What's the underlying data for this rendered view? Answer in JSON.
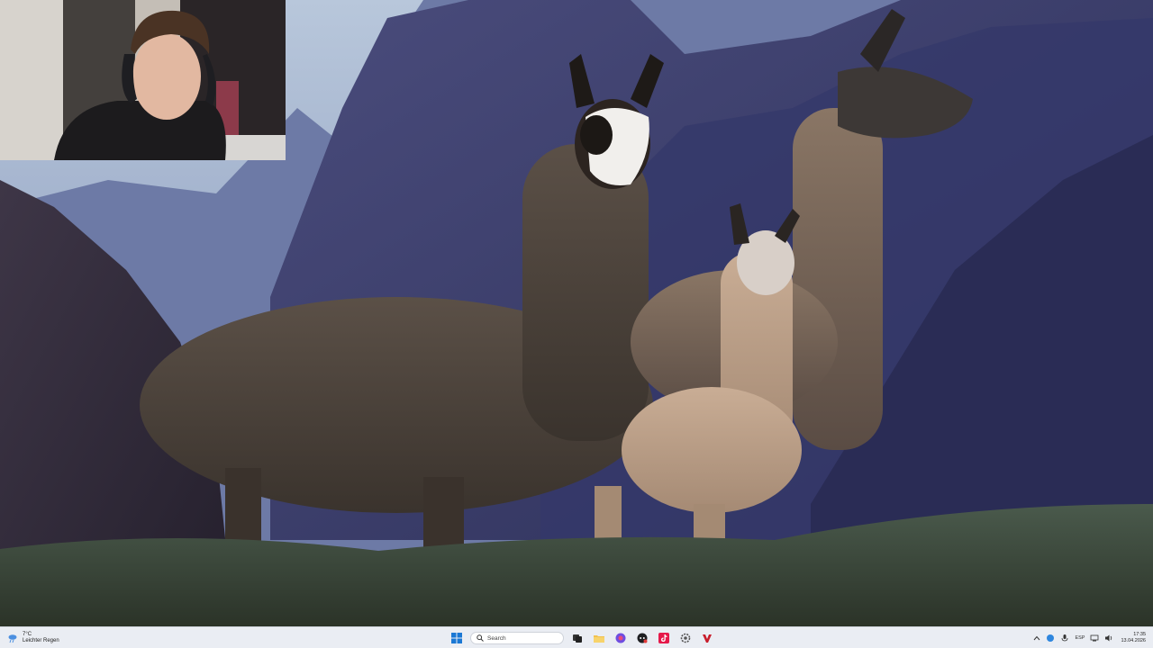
{
  "desktop": {
    "wallpaper": "llamas-in-mountains",
    "webcam_overlay": "streamer-webcam"
  },
  "taskbar": {
    "weather": {
      "temp": "7°C",
      "description": "Leichter Regen",
      "icon": "weather-rain-icon"
    },
    "search": {
      "placeholder": "Search"
    },
    "pinned_apps": [
      "windows-start",
      "search",
      "task-view",
      "file-explorer",
      "browser",
      "discord",
      "tiktok",
      "settings",
      "app"
    ],
    "tray": {
      "language": "ESP"
    },
    "clock": {
      "time": "17:35",
      "date": "13.04.2026"
    }
  },
  "colors": {
    "taskbar_bg": "#eaedf3",
    "sky": "#9fb3cf",
    "mountains": "#3a3f6e",
    "grass": "#3d4a3b"
  }
}
